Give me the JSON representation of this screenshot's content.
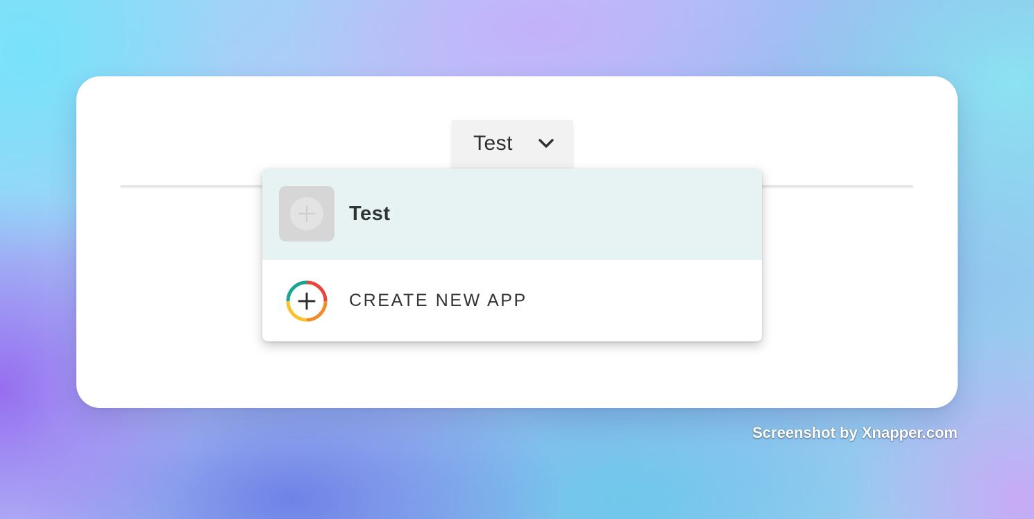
{
  "app_selector": {
    "label": "Test",
    "icon": "chevron-down-icon"
  },
  "dropdown": {
    "items": [
      {
        "label": "Test",
        "icon": "plus-icon",
        "selected": true
      },
      {
        "label": "CREATE NEW APP",
        "icon": "plus-circle-icon"
      }
    ]
  },
  "watermark": {
    "text": "Screenshot by Xnapper.com"
  },
  "colors": {
    "selected_row": "#e7f2f2",
    "ring_teal": "#1aa594",
    "ring_red": "#e8453c",
    "ring_orange": "#f28b2d",
    "ring_yellow": "#f7c22a"
  }
}
